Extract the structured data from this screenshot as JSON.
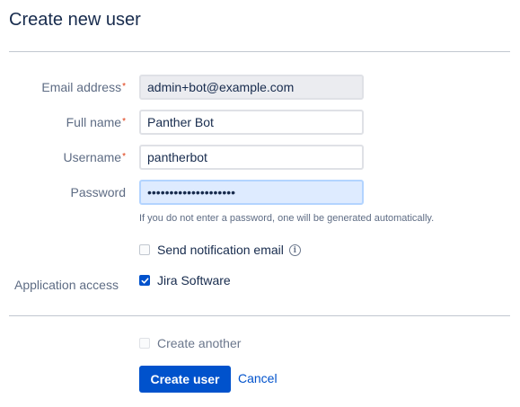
{
  "page": {
    "title": "Create new user"
  },
  "form": {
    "email": {
      "label": "Email address",
      "required_mark": "*",
      "value": "admin+bot@example.com"
    },
    "fullname": {
      "label": "Full name",
      "required_mark": "*",
      "value": "Panther Bot"
    },
    "username": {
      "label": "Username",
      "required_mark": "*",
      "value": "pantherbot"
    },
    "password": {
      "label": "Password",
      "value": "••••••••••••••••••••",
      "hint": "If you do not enter a password, one will be generated automatically."
    },
    "send_notification": {
      "label": "Send notification email",
      "checked": false,
      "info_icon": "info-icon"
    },
    "application_access": {
      "label": "Application access",
      "option_label": "Jira Software",
      "checked": true
    }
  },
  "footer": {
    "create_another": {
      "label": "Create another",
      "checked": false
    },
    "create_button": "Create user",
    "cancel_link": "Cancel"
  },
  "colors": {
    "primary": "#0052cc",
    "required": "#de350b",
    "password_bg": "#deebff"
  }
}
